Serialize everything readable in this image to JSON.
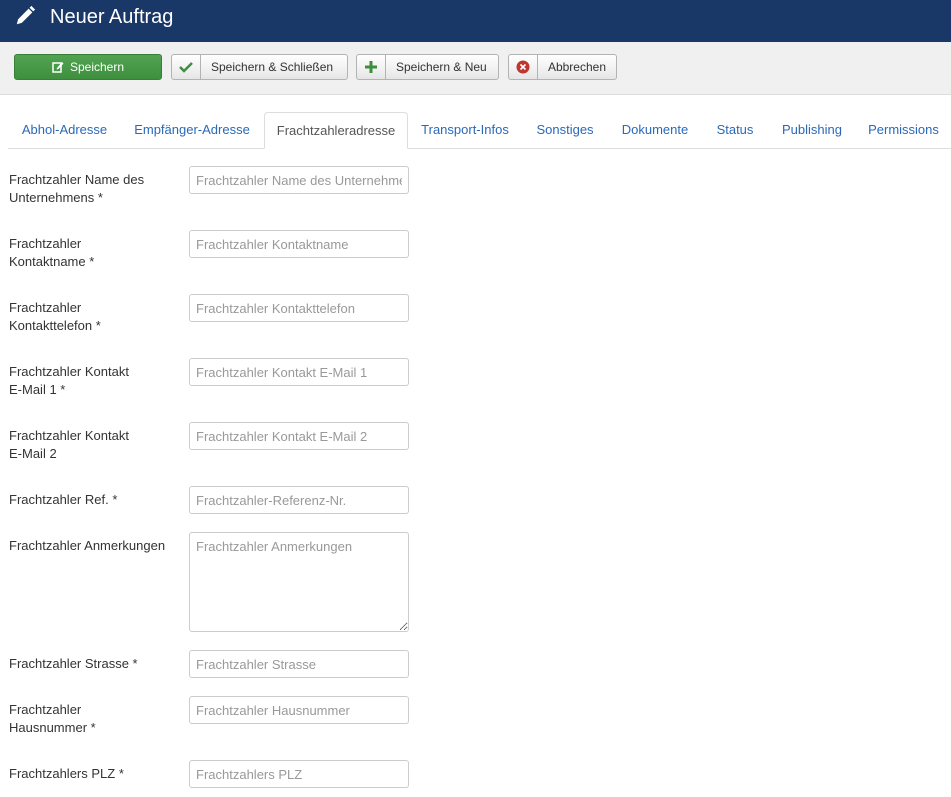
{
  "header": {
    "title": "Neuer Auftrag",
    "icon": "pencil-icon"
  },
  "toolbar": {
    "save": "Speichern",
    "save_close": "Speichern & Schließen",
    "save_new": "Speichern & Neu",
    "cancel": "Abbrechen"
  },
  "tabs": [
    {
      "label": "Abhol-Adresse"
    },
    {
      "label": "Empfänger-Adresse"
    },
    {
      "label": "Frachtzahleradresse",
      "active": true
    },
    {
      "label": "Transport-Infos"
    },
    {
      "label": "Sonstiges"
    },
    {
      "label": "Dokumente"
    },
    {
      "label": "Status"
    },
    {
      "label": "Publishing"
    },
    {
      "label": "Permissions"
    }
  ],
  "fields": [
    {
      "label": "Frachtzahler Name des Unternehmens *",
      "placeholder": "Frachtzahler Name des Unternehmens",
      "value": ""
    },
    {
      "label": "Frachtzahler Kontaktname *",
      "placeholder": "Frachtzahler Kontaktname",
      "value": ""
    },
    {
      "label": "Frachtzahler Kontakttelefon *",
      "placeholder": "Frachtzahler Kontakttelefon",
      "value": ""
    },
    {
      "label": "Frachtzahler Kontakt E-Mail 1 *",
      "placeholder": "Frachtzahler Kontakt E-Mail 1",
      "value": ""
    },
    {
      "label": "Frachtzahler Kontakt E-Mail 2",
      "placeholder": "Frachtzahler Kontakt E-Mail 2",
      "value": ""
    },
    {
      "label": "Frachtzahler Ref. *",
      "placeholder": "Frachtzahler-Referenz-Nr.",
      "value": ""
    },
    {
      "label": "Frachtzahler Anmerkungen",
      "placeholder": "Frachtzahler Anmerkungen",
      "value": ""
    },
    {
      "label": "Frachtzahler Strasse *",
      "placeholder": "Frachtzahler Strasse",
      "value": ""
    },
    {
      "label": "Frachtzahler Hausnummer *",
      "placeholder": "Frachtzahler Hausnummer",
      "value": ""
    },
    {
      "label": "Frachtzahlers PLZ *",
      "placeholder": "Frachtzahlers PLZ",
      "value": ""
    }
  ],
  "colors": {
    "header_bg": "#1a3867",
    "save_green": "#46a046",
    "link_blue": "#2a69b8"
  }
}
